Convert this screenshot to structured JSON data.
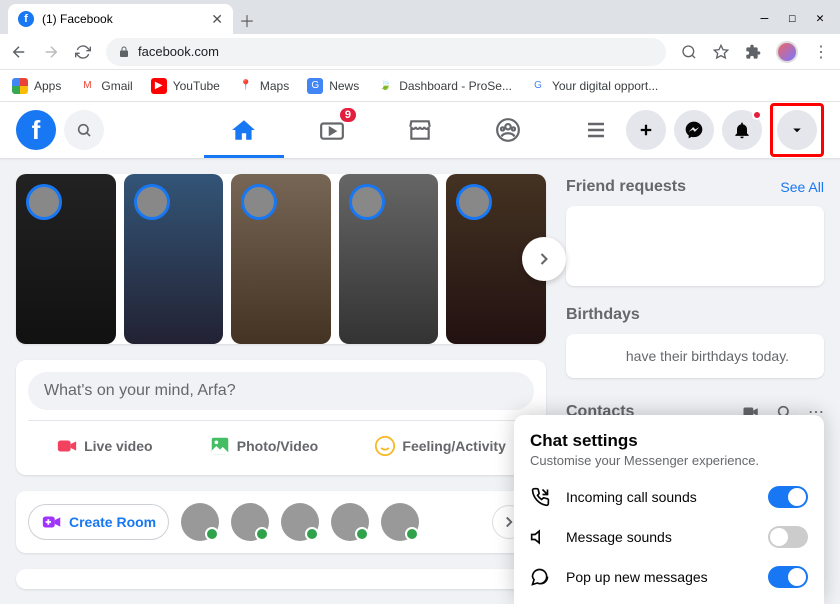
{
  "browser": {
    "tab_title": "(1) Facebook",
    "url": "facebook.com",
    "bookmarks": [
      {
        "label": "Apps"
      },
      {
        "label": "Gmail"
      },
      {
        "label": "YouTube"
      },
      {
        "label": "Maps"
      },
      {
        "label": "News"
      },
      {
        "label": "Dashboard - ProSe..."
      },
      {
        "label": "Your digital opport..."
      }
    ]
  },
  "fb": {
    "watch_badge": "9"
  },
  "composer": {
    "placeholder": "What's on your mind, Arfa?",
    "live": "Live video",
    "photo": "Photo/Video",
    "feeling": "Feeling/Activity"
  },
  "rooms": {
    "create": "Create Room"
  },
  "rightcol": {
    "friend_requests": "Friend requests",
    "see_all": "See All",
    "birthdays": "Birthdays",
    "bd_text": "have their birthdays today.",
    "contacts": "Contacts"
  },
  "chat": {
    "title": "Chat settings",
    "subtitle": "Customise your Messenger experience.",
    "rows": [
      {
        "label": "Incoming call sounds",
        "on": true
      },
      {
        "label": "Message sounds",
        "on": false
      },
      {
        "label": "Pop up new messages",
        "on": true
      }
    ]
  }
}
